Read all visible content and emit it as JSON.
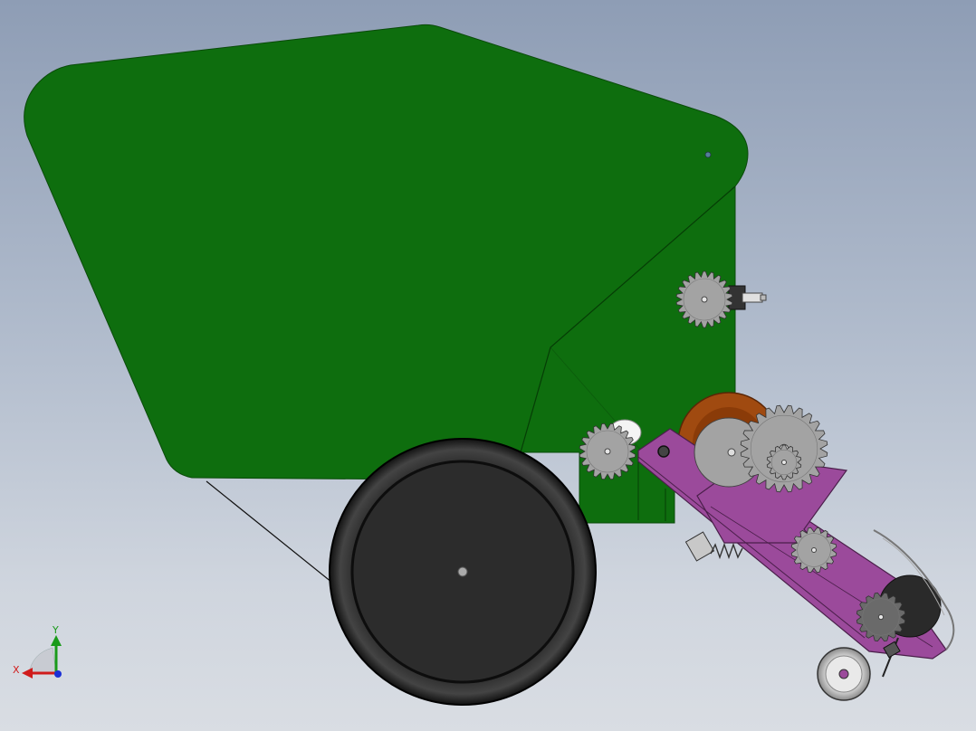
{
  "triad": {
    "x_label": "X",
    "y_label": "Y",
    "x_color": "#d01c1c",
    "y_color": "#1a9a1a",
    "z_color": "#1b2fd6"
  },
  "colors": {
    "hopper": "#0e6e0e",
    "hopper_edge": "#0a4f0a",
    "tire": "#1a1a1a",
    "rim": "#2c2c2c",
    "frame": "#9b4a9b",
    "gear": "#a3a3a3",
    "bronze_wheel": "#a04a10",
    "background_top": "#8e9db5",
    "background_bottom": "#d9dde3"
  },
  "icons": {
    "triad": "coordinate-triad-icon"
  }
}
